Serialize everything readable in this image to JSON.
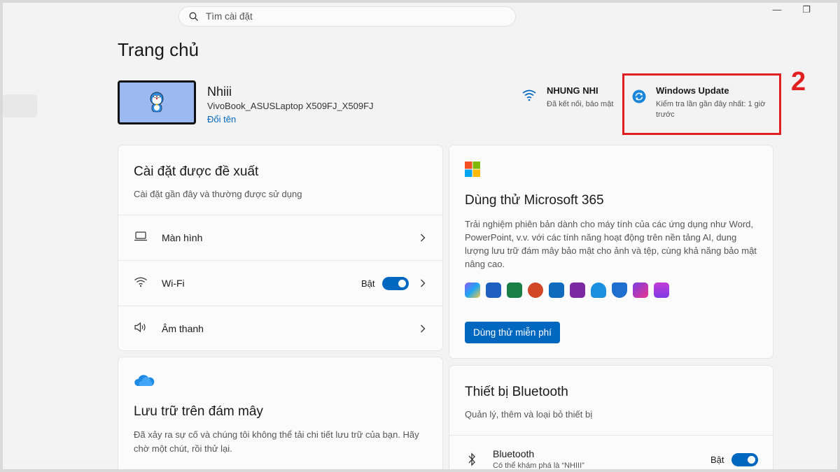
{
  "search": {
    "placeholder": "Tìm cài đặt"
  },
  "window_controls": {
    "minimize": "—",
    "restore": "❐"
  },
  "page_title": "Trang chủ",
  "device": {
    "name": "Nhiii",
    "model": "VivoBook_ASUSLaptop X509FJ_X509FJ",
    "rename_label": "Đổi tên"
  },
  "wifi_status": {
    "name": "NHUNG NHI",
    "status": "Đã kết nối, bảo mật"
  },
  "windows_update": {
    "title": "Windows Update",
    "subtitle": "Kiểm tra lần gần đây nhất: 1 giờ trước"
  },
  "annotation": {
    "number": "2",
    "color": "#e02020"
  },
  "recommended": {
    "title": "Cài đặt được đề xuất",
    "subtitle": "Cài đặt gần đây và thường được sử dụng",
    "rows": [
      {
        "label": "Màn hình",
        "icon": "monitor-icon"
      },
      {
        "label": "Wi-Fi",
        "icon": "wifi-icon",
        "toggle_label": "Bật",
        "toggle_on": true
      },
      {
        "label": "Âm thanh",
        "icon": "speaker-icon"
      }
    ]
  },
  "microsoft365": {
    "title": "Dùng thử Microsoft 365",
    "description": "Trải nghiệm phiên bản dành cho máy tính của các ứng dụng như Word, PowerPoint, v.v. với các tính năng hoạt động trên nền tảng AI, dung lượng lưu trữ đám mây bảo mật cho ảnh và tệp, cùng khả năng bảo mật nâng cao.",
    "button_label": "Dùng thử miễn phí",
    "apps": [
      "copilot-icon",
      "word-icon",
      "excel-icon",
      "powerpoint-icon",
      "outlook-icon",
      "onenote-icon",
      "onedrive-icon",
      "defender-icon",
      "clipchamp-icon",
      "designer-icon"
    ]
  },
  "cloud_storage": {
    "title": "Lưu trữ trên đám mây",
    "description": "Đã xảy ra sự cố và chúng tôi không thể tải chi tiết lưu trữ của bạn. Hãy chờ một chút, rồi thử lại."
  },
  "bluetooth": {
    "title": "Thiết bị Bluetooth",
    "subtitle": "Quản lý, thêm và loại bỏ thiết bị",
    "row_title": "Bluetooth",
    "row_sub": "Có thể khám phá là “NHIII”",
    "toggle_label": "Bật",
    "toggle_on": true
  },
  "colors": {
    "accent": "#0067c0",
    "highlight": "#e02020"
  }
}
